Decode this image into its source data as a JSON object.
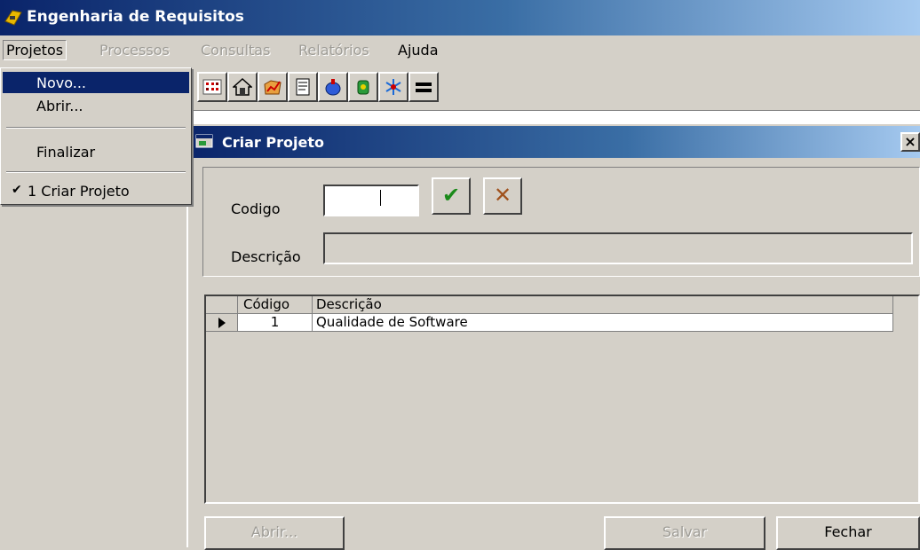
{
  "app": {
    "title": "Engenharia de Requisitos"
  },
  "menubar": {
    "items": [
      {
        "label": "Projetos",
        "state": "active"
      },
      {
        "label": "Processos",
        "state": "disabled"
      },
      {
        "label": "Consultas",
        "state": "disabled"
      },
      {
        "label": "Relatórios",
        "state": "disabled"
      },
      {
        "label": "Ajuda",
        "state": "enabled"
      }
    ]
  },
  "projetos_menu": {
    "items": [
      {
        "label": "Novo...",
        "highlighted": true
      },
      {
        "label": "Abrir..."
      },
      {
        "label": "Finalizar"
      },
      {
        "label": "1 Criar Projeto",
        "checked": true
      }
    ]
  },
  "toolbar": {
    "icons": [
      "grid-dots-icon",
      "house-icon",
      "folder-chart-icon",
      "document-icon",
      "cup-icon",
      "tool-icon",
      "snowflake-icon",
      "equals-icon"
    ]
  },
  "dialog": {
    "title": "Criar Projeto",
    "close_glyph": "×",
    "codigo_label": "Codigo",
    "codigo_value": "",
    "descricao_label": "Descrição",
    "descricao_value": "",
    "confirm_glyph": "✔",
    "cancel_glyph": "✕",
    "grid": {
      "columns": [
        "Código",
        "Descrição"
      ],
      "rows": [
        {
          "codigo": "1",
          "descricao": "Qualidade de Software"
        }
      ]
    },
    "buttons": {
      "abrir": "Abrir...",
      "salvar": "Salvar",
      "fechar": "Fechar"
    }
  },
  "colors": {
    "titlebar_start": "#0a246a",
    "titlebar_end": "#a6caf0",
    "face": "#d4d0c8",
    "confirm_green": "#1a8a1a",
    "cancel_brown": "#a0521e"
  }
}
